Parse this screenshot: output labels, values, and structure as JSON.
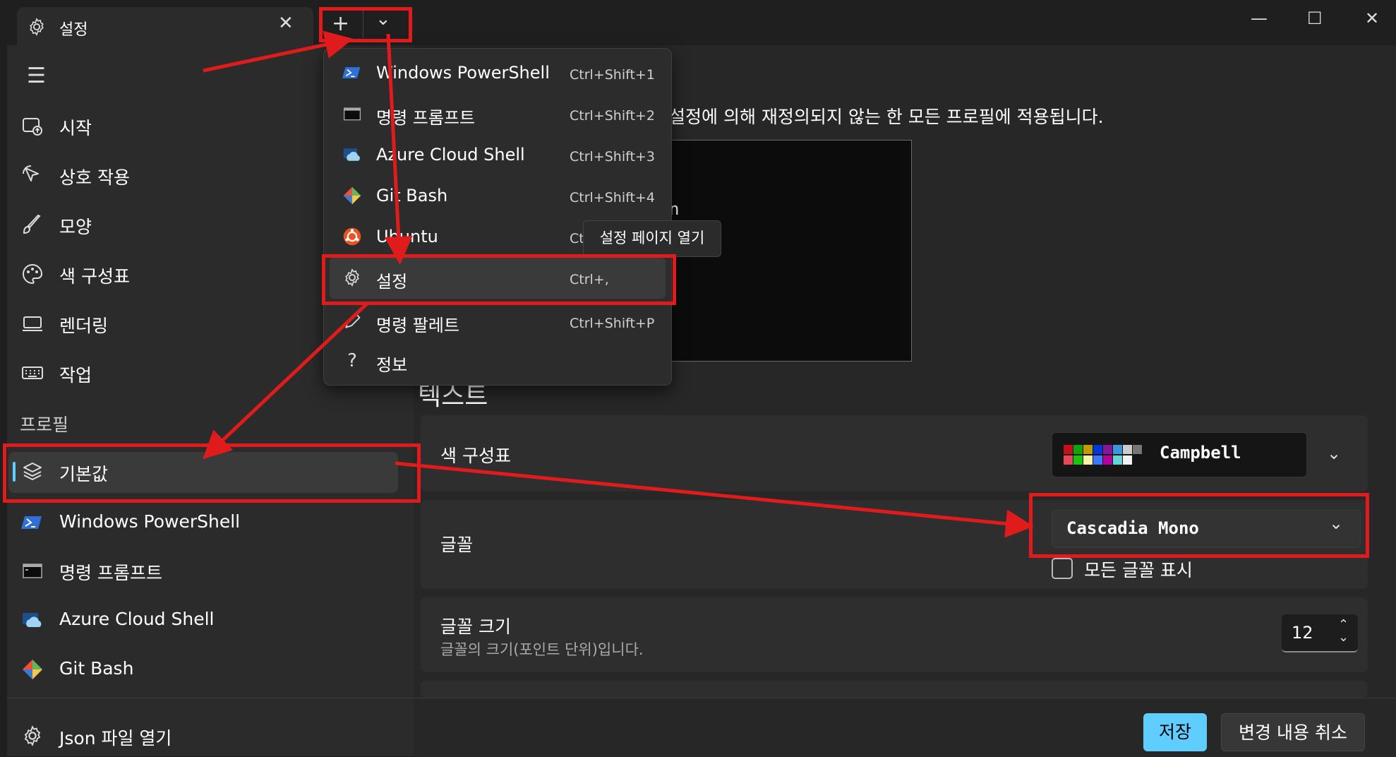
{
  "window": {
    "tab_title": "설정",
    "tab_close": "✕",
    "new_tab": "+",
    "dropdown": "⌄",
    "minimize": "—",
    "maximize": "☐",
    "close": "✕"
  },
  "sidebar": {
    "hamburger": "☰",
    "items": [
      {
        "label": "시작",
        "icon": "start-icon"
      },
      {
        "label": "상호 작용",
        "icon": "interaction-icon"
      },
      {
        "label": "모양",
        "icon": "brush-icon"
      },
      {
        "label": "색 구성표",
        "icon": "palette-icon"
      },
      {
        "label": "렌더링",
        "icon": "monitor-icon"
      },
      {
        "label": "작업",
        "icon": "keyboard-icon"
      }
    ],
    "profiles_header": "프로필",
    "profiles": [
      {
        "label": "기본값",
        "icon": "layers-icon"
      },
      {
        "label": "Windows PowerShell",
        "icon": "powershell-icon"
      },
      {
        "label": "명령 프롬프트",
        "icon": "cmd-icon"
      },
      {
        "label": "Azure Cloud Shell",
        "icon": "azure-icon"
      },
      {
        "label": "Git Bash",
        "icon": "git-icon"
      }
    ],
    "json_open": "Json 파일 열기"
  },
  "main": {
    "description": "설정에 의해 재정의되지 않는 한 모든 프로필에 적용됩니다.",
    "preview_text": "n",
    "section_title": "텍스트",
    "color_scheme_label": "색 구성표",
    "color_scheme_value": "Campbell",
    "font_label": "글꼴",
    "font_value": "Cascadia Mono",
    "show_all_fonts": "모든 글꼴 표시",
    "font_size_label": "글꼴 크기",
    "font_size_desc": "글꼴의 크기(포인트 단위)입니다.",
    "font_size_value": "12",
    "save": "저장",
    "cancel": "변경 내용 취소"
  },
  "menu": {
    "items": [
      {
        "label": "Windows PowerShell",
        "key": "Ctrl+Shift+1"
      },
      {
        "label": "명령 프롬프트",
        "key": "Ctrl+Shift+2"
      },
      {
        "label": "Azure Cloud Shell",
        "key": "Ctrl+Shift+3"
      },
      {
        "label": "Git Bash",
        "key": "Ctrl+Shift+4"
      },
      {
        "label": "Ubuntu",
        "key": "Ct"
      },
      {
        "label": "설정",
        "key": "Ctrl+,"
      },
      {
        "label": "명령 팔레트",
        "key": "Ctrl+Shift+P"
      },
      {
        "label": "정보",
        "key": ""
      }
    ],
    "tooltip": "설정 페이지 열기"
  },
  "colors": {
    "accent": "#60cdff",
    "annotation": "#e01b1b",
    "swatches": [
      "#c50f1f",
      "#13a10e",
      "#c19c00",
      "#0037da",
      "#881798",
      "#3a96dd",
      "#cccccc",
      "#767676",
      "#e74856",
      "#16c60c",
      "#f9f1a5",
      "#3b78ff",
      "#b4009e",
      "#61d6d6",
      "#f2f2f2"
    ]
  }
}
